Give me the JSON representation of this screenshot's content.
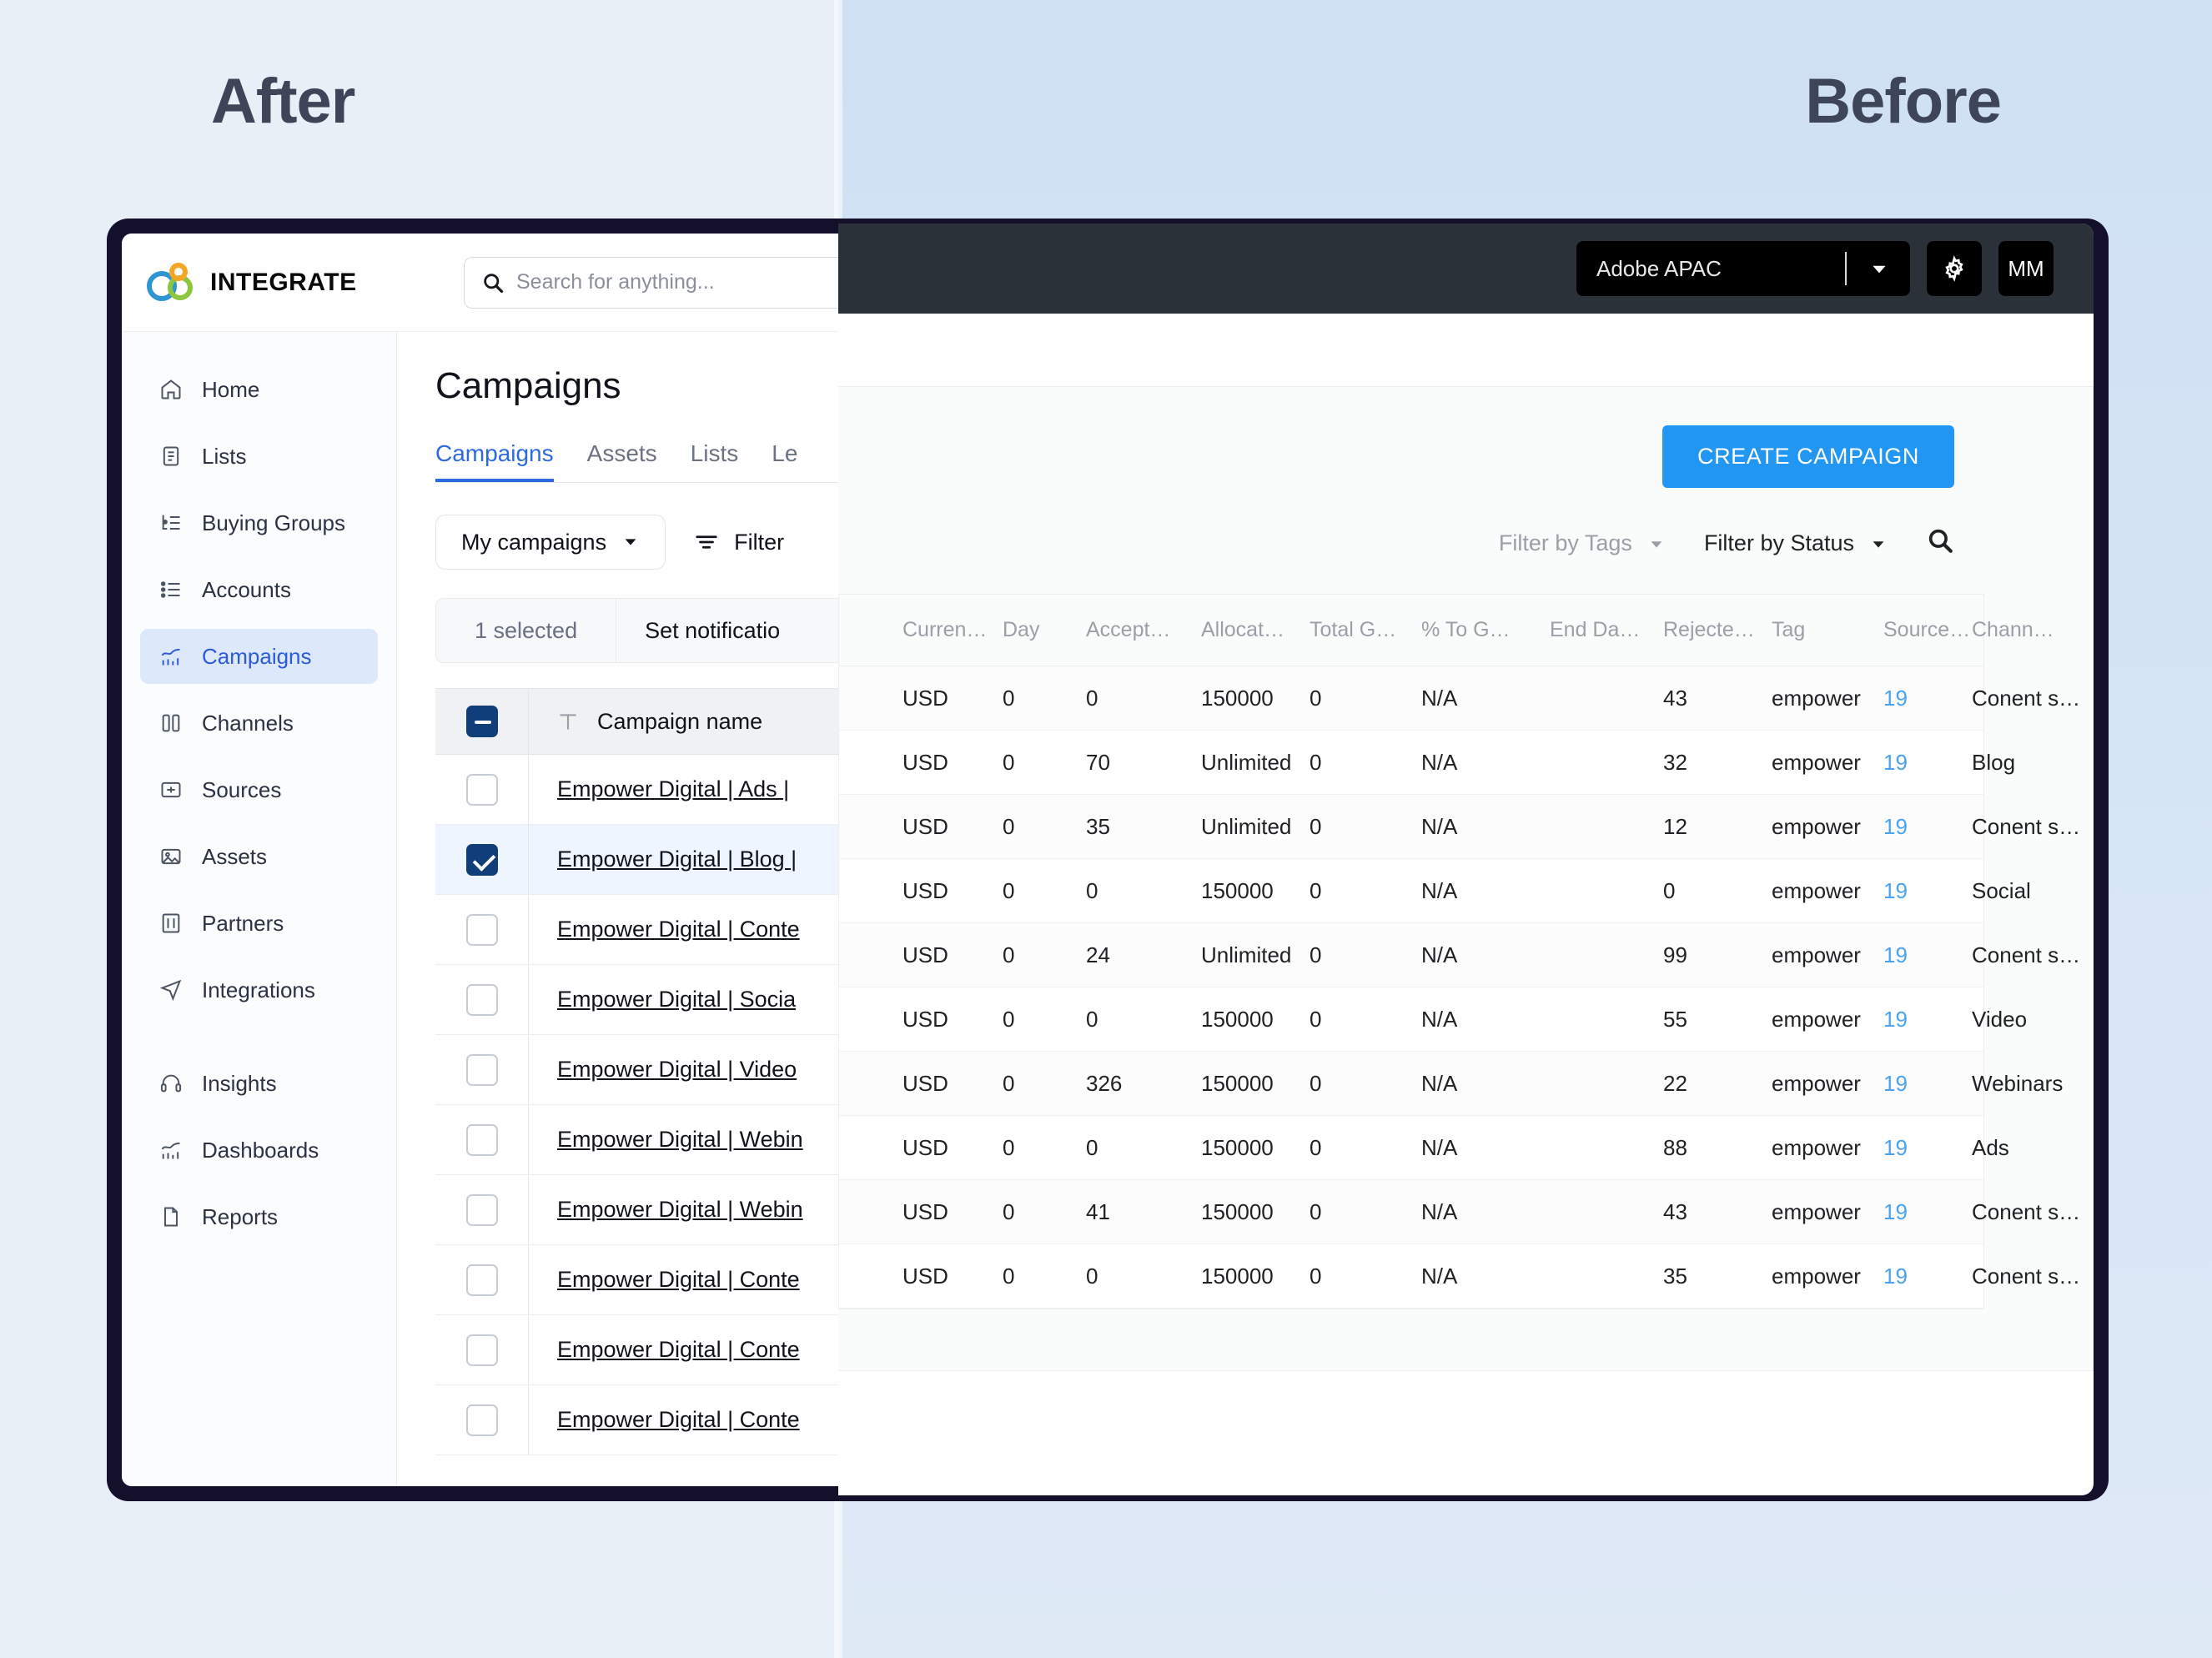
{
  "captions": {
    "after": "After",
    "before": "Before"
  },
  "after": {
    "brand": {
      "name": "INTEGRATE",
      "logo_icon": "integrate-logo-icon",
      "colors": {
        "blue": "#2e95d3",
        "orange": "#f5a623",
        "green": "#8cc63f"
      }
    },
    "search": {
      "icon": "search-icon",
      "placeholder": "Search for anything...",
      "value": ""
    },
    "sidebar": {
      "items": [
        {
          "label": "Home",
          "icon": "home-icon",
          "active": false
        },
        {
          "label": "Lists",
          "icon": "list-document-icon",
          "active": false
        },
        {
          "label": "Buying Groups",
          "icon": "buying-groups-icon",
          "active": false
        },
        {
          "label": "Accounts",
          "icon": "accounts-list-icon",
          "active": false
        },
        {
          "label": "Campaigns",
          "icon": "campaigns-chart-icon",
          "active": true
        },
        {
          "label": "Channels",
          "icon": "channels-icon",
          "active": false
        },
        {
          "label": "Sources",
          "icon": "sources-icon",
          "active": false
        },
        {
          "label": "Assets",
          "icon": "assets-image-icon",
          "active": false
        },
        {
          "label": "Partners",
          "icon": "partners-icon",
          "active": false
        },
        {
          "label": "Integrations",
          "icon": "integrations-icon",
          "active": false
        }
      ],
      "items_secondary": [
        {
          "label": "Insights",
          "icon": "insights-headset-icon",
          "active": false
        },
        {
          "label": "Dashboards",
          "icon": "dashboards-chart-icon",
          "active": false
        },
        {
          "label": "Reports",
          "icon": "reports-icon",
          "active": false
        }
      ]
    },
    "page_title": "Campaigns",
    "tabs": [
      {
        "label": "Campaigns",
        "active": true
      },
      {
        "label": "Assets",
        "active": false
      },
      {
        "label": "Lists",
        "active": false
      },
      {
        "label": "Le",
        "active": false
      }
    ],
    "toolbar": {
      "my_campaigns_label": "My campaigns",
      "my_campaigns_chevron": "chevron-down-icon",
      "filter_label": "Filter",
      "filter_icon": "filter-lines-icon"
    },
    "selection_bar": {
      "count_label": "1 selected",
      "action_label": "Set notificatio"
    },
    "table": {
      "header_checkbox_state": "indeterminate",
      "name_column_icon": "text-type-icon",
      "name_column_label": "Campaign name",
      "rows": [
        {
          "name": "Empower Digital | Ads |",
          "checked": false
        },
        {
          "name": "Empower Digital | Blog |",
          "checked": true
        },
        {
          "name": "Empower Digital | Conte",
          "checked": false
        },
        {
          "name": "Empower Digital | Socia",
          "checked": false
        },
        {
          "name": "Empower Digital | Video",
          "checked": false
        },
        {
          "name": "Empower Digital | Webin",
          "checked": false
        },
        {
          "name": "Empower Digital | Webin",
          "checked": false
        },
        {
          "name": "Empower Digital | Conte",
          "checked": false
        },
        {
          "name": "Empower Digital | Conte",
          "checked": false
        },
        {
          "name": "Empower Digital | Conte",
          "checked": false
        }
      ]
    }
  },
  "before": {
    "topbar": {
      "org_value": "Adobe APAC",
      "org_chevron": "chevron-down-icon",
      "settings_icon": "gear-icon",
      "avatar_initials": "MM"
    },
    "create_button": "CREATE CAMPAIGN",
    "filters": {
      "tags_label": "Filter by Tags",
      "tags_chevron": "chevron-down-icon",
      "status_label": "Filter by Status",
      "status_chevron": "chevron-down-icon",
      "search_icon": "search-icon"
    },
    "table": {
      "settings_icon": "gear-icon",
      "row_menu_icon": "kebab-menu-icon",
      "columns": [
        "Curren…",
        "Day",
        "Accept…",
        "Allocat…",
        "Total G…",
        "% To G…",
        "End Da…",
        "Rejecte…",
        "Tag",
        "Source…",
        "Chann…"
      ],
      "rows": [
        {
          "currency": "USD",
          "day": "0",
          "accepted": "0",
          "allocated": "150000",
          "total_goal": "0",
          "pct_to_goal": "N/A",
          "end_date": "",
          "rejected": "43",
          "tag": "empower",
          "source": "19",
          "channel": "Conent s…"
        },
        {
          "currency": "USD",
          "day": "0",
          "accepted": "70",
          "allocated": "Unlimited",
          "total_goal": "0",
          "pct_to_goal": "N/A",
          "end_date": "",
          "rejected": "32",
          "tag": "empower",
          "source": "19",
          "channel": "Blog"
        },
        {
          "currency": "USD",
          "day": "0",
          "accepted": "35",
          "allocated": "Unlimited",
          "total_goal": "0",
          "pct_to_goal": "N/A",
          "end_date": "",
          "rejected": "12",
          "tag": "empower",
          "source": "19",
          "channel": "Conent s…"
        },
        {
          "currency": "USD",
          "day": "0",
          "accepted": "0",
          "allocated": "150000",
          "total_goal": "0",
          "pct_to_goal": "N/A",
          "end_date": "",
          "rejected": "0",
          "tag": "empower",
          "source": "19",
          "channel": "Social"
        },
        {
          "currency": "USD",
          "day": "0",
          "accepted": "24",
          "allocated": "Unlimited",
          "total_goal": "0",
          "pct_to_goal": "N/A",
          "end_date": "",
          "rejected": "99",
          "tag": "empower",
          "source": "19",
          "channel": "Conent s…"
        },
        {
          "currency": "USD",
          "day": "0",
          "accepted": "0",
          "allocated": "150000",
          "total_goal": "0",
          "pct_to_goal": "N/A",
          "end_date": "",
          "rejected": "55",
          "tag": "empower",
          "source": "19",
          "channel": "Video"
        },
        {
          "currency": "USD",
          "day": "0",
          "accepted": "326",
          "allocated": "150000",
          "total_goal": "0",
          "pct_to_goal": "N/A",
          "end_date": "",
          "rejected": "22",
          "tag": "empower",
          "source": "19",
          "channel": "Webinars"
        },
        {
          "currency": "USD",
          "day": "0",
          "accepted": "0",
          "allocated": "150000",
          "total_goal": "0",
          "pct_to_goal": "N/A",
          "end_date": "",
          "rejected": "88",
          "tag": "empower",
          "source": "19",
          "channel": "Ads"
        },
        {
          "currency": "USD",
          "day": "0",
          "accepted": "41",
          "allocated": "150000",
          "total_goal": "0",
          "pct_to_goal": "N/A",
          "end_date": "",
          "rejected": "43",
          "tag": "empower",
          "source": "19",
          "channel": "Conent s…"
        },
        {
          "currency": "USD",
          "day": "0",
          "accepted": "0",
          "allocated": "150000",
          "total_goal": "0",
          "pct_to_goal": "N/A",
          "end_date": "",
          "rejected": "35",
          "tag": "empower",
          "source": "19",
          "channel": "Conent s…"
        }
      ]
    }
  }
}
